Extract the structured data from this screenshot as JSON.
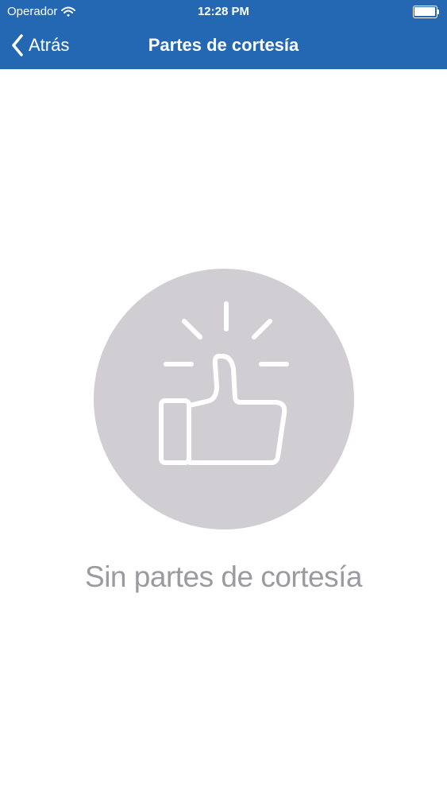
{
  "status_bar": {
    "carrier": "Operador",
    "time": "12:28 PM",
    "wifi_icon": "wifi-icon",
    "battery_icon": "battery-icon"
  },
  "nav": {
    "back_label": "Atrás",
    "back_icon": "chevron-left-icon",
    "title": "Partes de cortesía"
  },
  "empty_state": {
    "icon": "thumbs-up-icon",
    "message": "Sin partes de cortesía"
  },
  "colors": {
    "header_background": "#2468b4",
    "circle": "#d0ced3",
    "message_text": "#9a9aa0",
    "icon_stroke": "#ffffff"
  }
}
